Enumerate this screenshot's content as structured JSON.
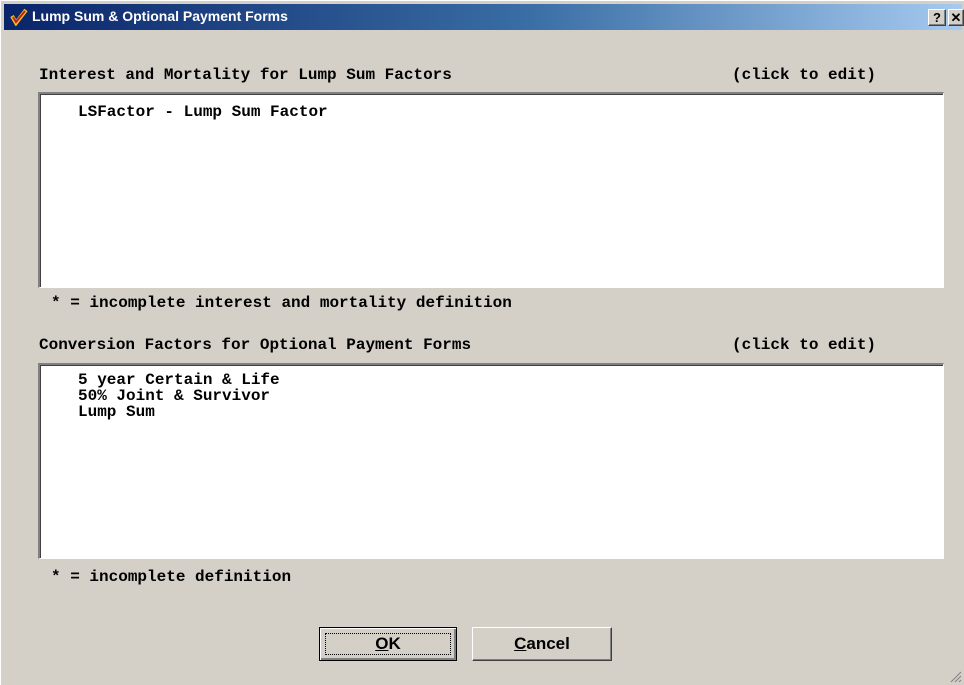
{
  "window": {
    "title": "Lump Sum & Optional Payment Forms",
    "help_label": "?",
    "close_label": "✕"
  },
  "section1": {
    "heading": "Interest and Mortality for Lump Sum Factors",
    "edit_hint": "(click to edit)",
    "items": [
      "LSFactor - Lump Sum Factor"
    ],
    "footnote": "* = incomplete interest and mortality definition"
  },
  "section2": {
    "heading": "Conversion Factors for Optional Payment Forms",
    "edit_hint": "(click to edit)",
    "items": [
      "5 year Certain & Life",
      "50% Joint & Survivor",
      "Lump Sum"
    ],
    "footnote": "* = incomplete definition"
  },
  "buttons": {
    "ok_accel": "O",
    "ok_rest": "K",
    "cancel_accel": "C",
    "cancel_rest": "ancel"
  }
}
